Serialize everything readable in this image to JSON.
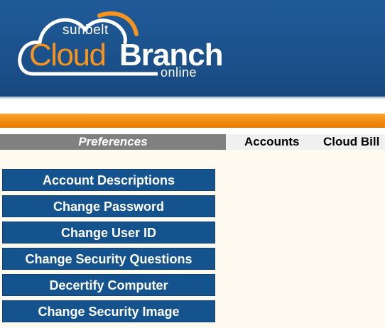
{
  "logo": {
    "sunbelt": "sunbelt",
    "cloud": "Cloud",
    "branch": "Branch",
    "online": "online",
    "colors": {
      "cloud": "#f7941e",
      "outline": "#ffffff",
      "arc": "#f7941e"
    }
  },
  "nav": {
    "active_tab": "Preferences",
    "tabs": [
      "Accounts",
      "Cloud Bill"
    ]
  },
  "menu": {
    "items": [
      "Account Descriptions",
      "Change Password",
      "Change User ID",
      "Change Security Questions",
      "Decertify Computer",
      "Change Security Image"
    ]
  },
  "colors": {
    "header_blue": "#1a4f88",
    "orange_band": "#f28b11",
    "active_tab_gray": "#808080",
    "menu_button_blue": "#15538f",
    "content_bg": "#fffaf0"
  }
}
